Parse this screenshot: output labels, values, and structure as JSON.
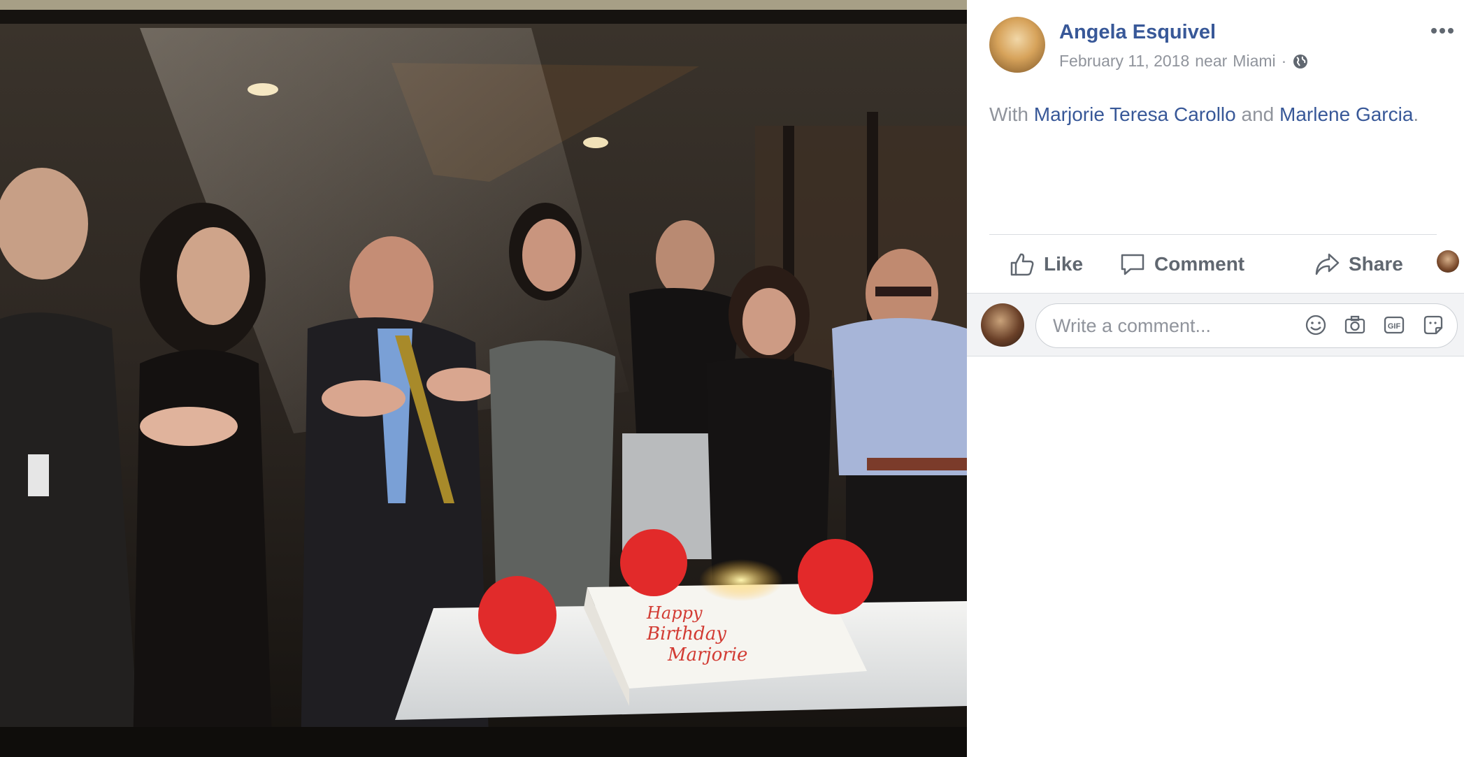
{
  "post": {
    "author_name": "Angela Esquivel",
    "date": "February 11, 2018",
    "location_prefix": "near",
    "location": "Miami",
    "separator": "·",
    "audience_icon": "globe-icon",
    "with_prefix": "With",
    "tagged_1": "Marjorie Teresa Carollo",
    "and_word": "and",
    "tagged_2": "Marlene Garcia",
    "period": ".",
    "cake_text": [
      "Happy",
      "Birthday",
      "Marjorie"
    ]
  },
  "actions": {
    "like": "Like",
    "comment": "Comment",
    "share": "Share"
  },
  "comment_box": {
    "placeholder": "Write a comment..."
  },
  "colors": {
    "link": "#385898",
    "meta": "#90949c",
    "action": "#606770",
    "comment_bg": "#f2f3f5"
  }
}
